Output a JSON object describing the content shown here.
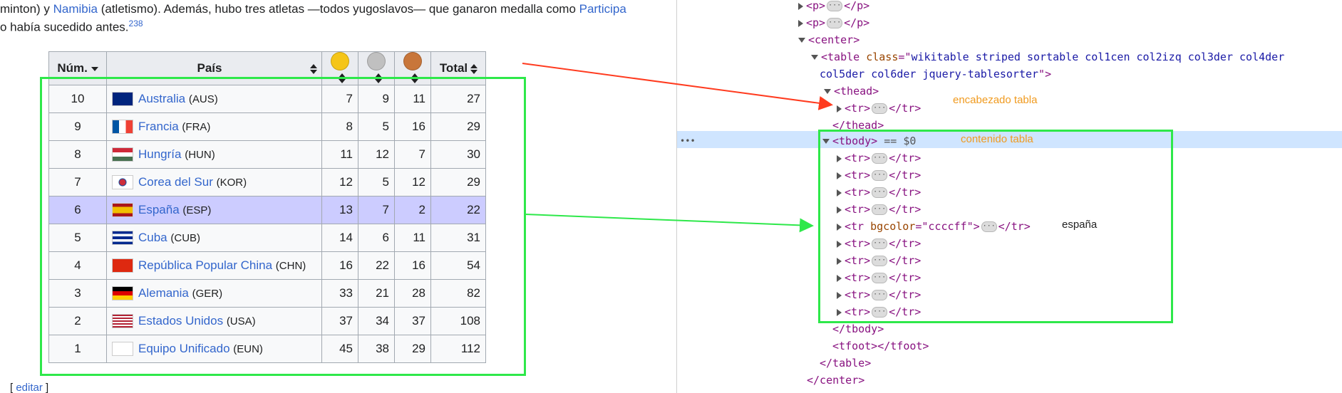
{
  "article": {
    "line1": {
      "pre": "minton) y ",
      "link1": "Namibia",
      "mid": " (atletismo). Además, hubo tres atletas —todos yugoslavos— que ganaron medalla como ",
      "link2": "Participa"
    },
    "line2": {
      "text": "o había sucedido antes.",
      "ref": "238"
    },
    "edit": {
      "open": "[ ",
      "label": "editar",
      "close": " ]"
    }
  },
  "table": {
    "headers": [
      "Núm.",
      "País",
      "Total"
    ],
    "medal_colors": [
      "#f5c518",
      "#c0c0c0",
      "#c8763a"
    ],
    "rows": [
      {
        "rank": "10",
        "country": "Australia",
        "code": "(AUS)",
        "gold": "7",
        "silver": "9",
        "bronze": "11",
        "total": "27"
      },
      {
        "rank": "9",
        "country": "Francia",
        "code": "(FRA)",
        "gold": "8",
        "silver": "5",
        "bronze": "16",
        "total": "29"
      },
      {
        "rank": "8",
        "country": "Hungría",
        "code": "(HUN)",
        "gold": "11",
        "silver": "12",
        "bronze": "7",
        "total": "30"
      },
      {
        "rank": "7",
        "country": "Corea del Sur",
        "code": "(KOR)",
        "gold": "12",
        "silver": "5",
        "bronze": "12",
        "total": "29"
      },
      {
        "rank": "6",
        "country": "España",
        "code": "(ESP)",
        "gold": "13",
        "silver": "7",
        "bronze": "2",
        "total": "22"
      },
      {
        "rank": "5",
        "country": "Cuba",
        "code": "(CUB)",
        "gold": "14",
        "silver": "6",
        "bronze": "11",
        "total": "31"
      },
      {
        "rank": "4",
        "country": "República Popular China",
        "code": "(CHN)",
        "gold": "16",
        "silver": "22",
        "bronze": "16",
        "total": "54"
      },
      {
        "rank": "3",
        "country": "Alemania",
        "code": "(GER)",
        "gold": "33",
        "silver": "21",
        "bronze": "28",
        "total": "82"
      },
      {
        "rank": "2",
        "country": "Estados Unidos",
        "code": "(USA)",
        "gold": "37",
        "silver": "34",
        "bronze": "37",
        "total": "108"
      },
      {
        "rank": "1",
        "country": "Equipo Unificado",
        "code": "(EUN)",
        "gold": "45",
        "silver": "38",
        "bronze": "29",
        "total": "112"
      }
    ],
    "highlight_color": "#ccccff"
  },
  "devtools": {
    "p_tag_open": "<p>",
    "p_tag_close": "</p>",
    "center_open": "<center>",
    "table_open_start": "<table ",
    "class_attr": "class",
    "class_eq": "=\"",
    "class_value_line1": "wikitable striped sortable col1cen col2izq col3der col4der",
    "class_value_line2": "col5der col6der jquery-tablesorter",
    "table_open_end": "\">",
    "thead_open": "<thead>",
    "thead_close": "</thead>",
    "tr_open": "<tr>",
    "tr_close": "</tr>",
    "tbody_open": "<tbody>",
    "selected_marker": "== $0",
    "tr_bg_open": "<tr ",
    "bgcolor_attr": "bgcolor",
    "bgcolor_val": "=\"ccccff\">",
    "tbody_close": "</tbody>",
    "tfoot": "<tfoot></tfoot>",
    "table_close": "</table>",
    "center_close": "</center>",
    "row_menu": "•••",
    "annotations": {
      "header": "encabezado tabla",
      "body": "contenido tabla",
      "espana": "españa"
    },
    "colors": {
      "arrow_red": "#ff3b1f",
      "arrow_green": "#2ee84a",
      "annotation": "#f09a1e"
    }
  }
}
